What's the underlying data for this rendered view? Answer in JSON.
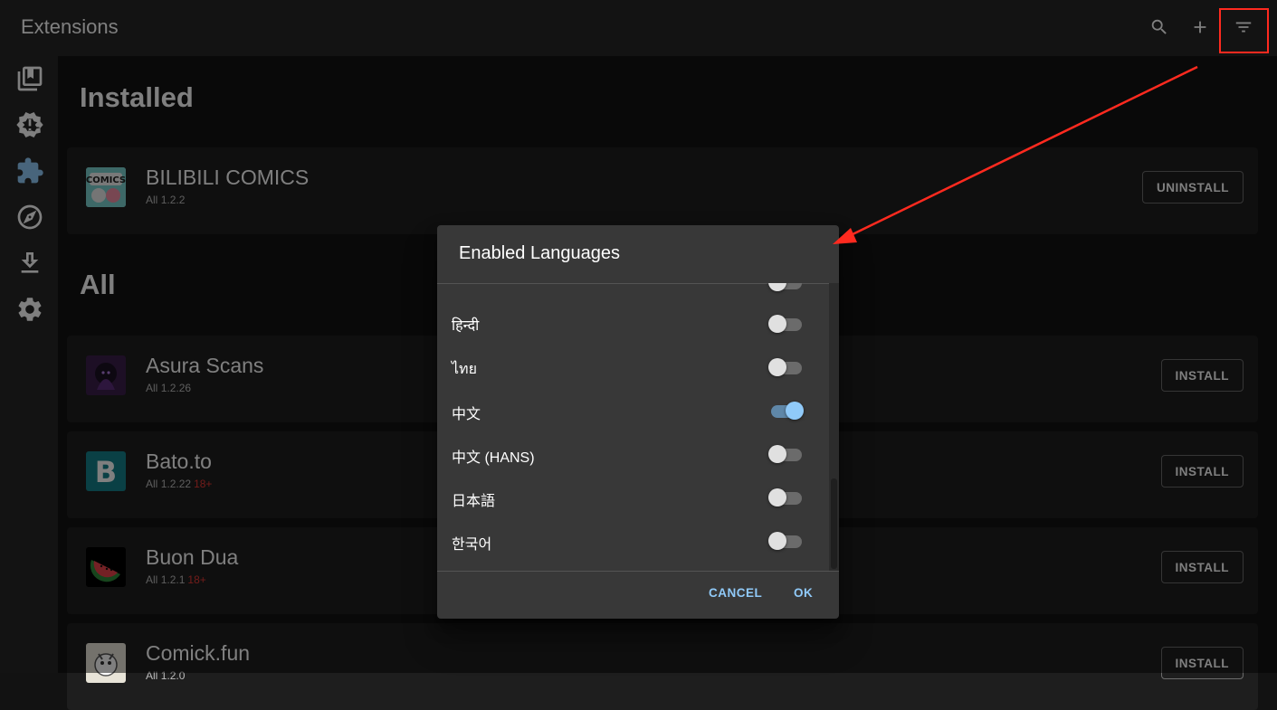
{
  "appbar": {
    "title": "Extensions",
    "actions": [
      "search-icon",
      "add-icon",
      "filter-icon"
    ]
  },
  "sidebar": {
    "items": [
      {
        "icon": "library-icon",
        "active": false
      },
      {
        "icon": "updates-icon",
        "active": false
      },
      {
        "icon": "extensions-icon",
        "active": true
      },
      {
        "icon": "browse-icon",
        "active": false
      },
      {
        "icon": "downloads-icon",
        "active": false
      },
      {
        "icon": "settings-icon",
        "active": false
      }
    ]
  },
  "sections": {
    "installed_title": "Installed",
    "all_title": "All"
  },
  "installed": [
    {
      "name": "BILIBILI COMICS",
      "lang": "All",
      "version": "1.2.2",
      "nsfw": "",
      "action": "UNINSTALL"
    }
  ],
  "all": [
    {
      "name": "Asura Scans",
      "lang": "All",
      "version": "1.2.26",
      "nsfw": "",
      "action": "INSTALL"
    },
    {
      "name": "Bato.to",
      "lang": "All",
      "version": "1.2.22",
      "nsfw": "18+",
      "action": "INSTALL"
    },
    {
      "name": "Buon Dua",
      "lang": "All",
      "version": "1.2.1",
      "nsfw": "18+",
      "action": "INSTALL"
    },
    {
      "name": "Comick.fun",
      "lang": "All",
      "version": "1.2.0",
      "nsfw": "",
      "action": "INSTALL"
    }
  ],
  "dialog": {
    "title": "Enabled Languages",
    "languages": [
      {
        "label": "हिन्दी",
        "enabled": false
      },
      {
        "label": "ไทย",
        "enabled": false
      },
      {
        "label": "中文",
        "enabled": true
      },
      {
        "label": "中文 (HANS)",
        "enabled": false
      },
      {
        "label": "日本語",
        "enabled": false
      },
      {
        "label": "한국어",
        "enabled": false
      }
    ],
    "cancel_label": "CANCEL",
    "ok_label": "OK"
  },
  "colors": {
    "accent": "#90caf9",
    "annotation": "#ff2a1f",
    "nsfw": "#e53935"
  }
}
